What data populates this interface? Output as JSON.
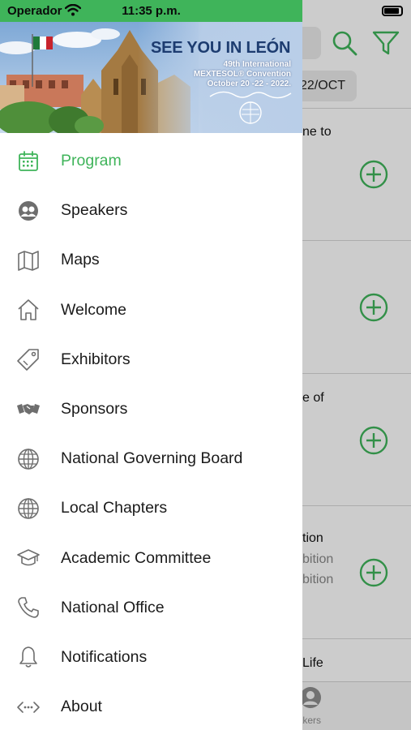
{
  "status_bar": {
    "carrier": "Operador",
    "time": "11:35 p.m."
  },
  "banner": {
    "title": "SEE YOU IN LEÓN",
    "line1": "49th International",
    "line2": "MEXTESOL® Convention",
    "line3": "October 20 -22 - 2022."
  },
  "menu": {
    "items": [
      {
        "label": "Program",
        "icon": "calendar-icon",
        "active": true
      },
      {
        "label": "Speakers",
        "icon": "speakers-icon"
      },
      {
        "label": "Maps",
        "icon": "map-icon"
      },
      {
        "label": "Welcome",
        "icon": "home-icon"
      },
      {
        "label": "Exhibitors",
        "icon": "tag-icon"
      },
      {
        "label": "Sponsors",
        "icon": "handshake-icon"
      },
      {
        "label": "National Governing Board",
        "icon": "globe-icon"
      },
      {
        "label": "Local Chapters",
        "icon": "globe-icon"
      },
      {
        "label": "Academic Committee",
        "icon": "graduation-cap-icon"
      },
      {
        "label": "National Office",
        "icon": "phone-icon"
      },
      {
        "label": "Notifications",
        "icon": "bell-icon"
      },
      {
        "label": "About",
        "icon": "code-icon"
      }
    ]
  },
  "background": {
    "date_chip": "22/OCT",
    "rows": [
      {
        "line1": "ne to",
        "line2": "",
        "line3": ""
      },
      {
        "line1": "",
        "line2": "",
        "line3": ""
      },
      {
        "line1": "e of",
        "line2": "",
        "line3": ""
      },
      {
        "line1": "tion",
        "line2": "bition",
        "line3": "bition"
      },
      {
        "line1": "Life",
        "line2": "",
        "line3": ""
      }
    ],
    "tab_label": "eakers"
  },
  "colors": {
    "accent": "#3fb45a",
    "icon_gray": "#6e6e6e"
  }
}
